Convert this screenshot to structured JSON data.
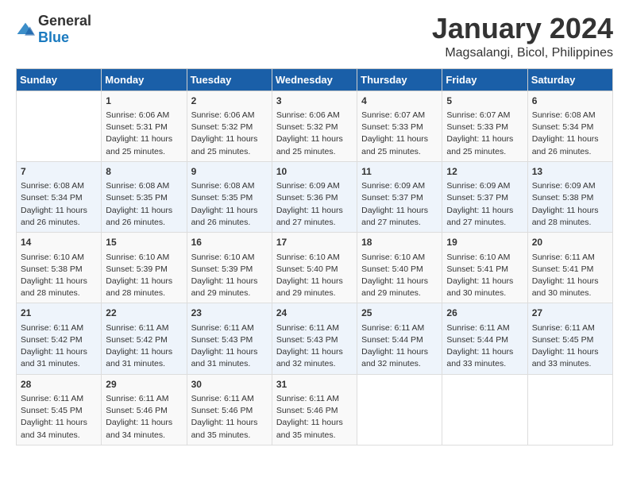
{
  "header": {
    "logo_general": "General",
    "logo_blue": "Blue",
    "month_year": "January 2024",
    "location": "Magsalangi, Bicol, Philippines"
  },
  "days_of_week": [
    "Sunday",
    "Monday",
    "Tuesday",
    "Wednesday",
    "Thursday",
    "Friday",
    "Saturday"
  ],
  "weeks": [
    [
      {
        "day": "",
        "sunrise": "",
        "sunset": "",
        "daylight": ""
      },
      {
        "day": "1",
        "sunrise": "Sunrise: 6:06 AM",
        "sunset": "Sunset: 5:31 PM",
        "daylight": "Daylight: 11 hours and 25 minutes."
      },
      {
        "day": "2",
        "sunrise": "Sunrise: 6:06 AM",
        "sunset": "Sunset: 5:32 PM",
        "daylight": "Daylight: 11 hours and 25 minutes."
      },
      {
        "day": "3",
        "sunrise": "Sunrise: 6:06 AM",
        "sunset": "Sunset: 5:32 PM",
        "daylight": "Daylight: 11 hours and 25 minutes."
      },
      {
        "day": "4",
        "sunrise": "Sunrise: 6:07 AM",
        "sunset": "Sunset: 5:33 PM",
        "daylight": "Daylight: 11 hours and 25 minutes."
      },
      {
        "day": "5",
        "sunrise": "Sunrise: 6:07 AM",
        "sunset": "Sunset: 5:33 PM",
        "daylight": "Daylight: 11 hours and 25 minutes."
      },
      {
        "day": "6",
        "sunrise": "Sunrise: 6:08 AM",
        "sunset": "Sunset: 5:34 PM",
        "daylight": "Daylight: 11 hours and 26 minutes."
      }
    ],
    [
      {
        "day": "7",
        "sunrise": "Sunrise: 6:08 AM",
        "sunset": "Sunset: 5:34 PM",
        "daylight": "Daylight: 11 hours and 26 minutes."
      },
      {
        "day": "8",
        "sunrise": "Sunrise: 6:08 AM",
        "sunset": "Sunset: 5:35 PM",
        "daylight": "Daylight: 11 hours and 26 minutes."
      },
      {
        "day": "9",
        "sunrise": "Sunrise: 6:08 AM",
        "sunset": "Sunset: 5:35 PM",
        "daylight": "Daylight: 11 hours and 26 minutes."
      },
      {
        "day": "10",
        "sunrise": "Sunrise: 6:09 AM",
        "sunset": "Sunset: 5:36 PM",
        "daylight": "Daylight: 11 hours and 27 minutes."
      },
      {
        "day": "11",
        "sunrise": "Sunrise: 6:09 AM",
        "sunset": "Sunset: 5:37 PM",
        "daylight": "Daylight: 11 hours and 27 minutes."
      },
      {
        "day": "12",
        "sunrise": "Sunrise: 6:09 AM",
        "sunset": "Sunset: 5:37 PM",
        "daylight": "Daylight: 11 hours and 27 minutes."
      },
      {
        "day": "13",
        "sunrise": "Sunrise: 6:09 AM",
        "sunset": "Sunset: 5:38 PM",
        "daylight": "Daylight: 11 hours and 28 minutes."
      }
    ],
    [
      {
        "day": "14",
        "sunrise": "Sunrise: 6:10 AM",
        "sunset": "Sunset: 5:38 PM",
        "daylight": "Daylight: 11 hours and 28 minutes."
      },
      {
        "day": "15",
        "sunrise": "Sunrise: 6:10 AM",
        "sunset": "Sunset: 5:39 PM",
        "daylight": "Daylight: 11 hours and 28 minutes."
      },
      {
        "day": "16",
        "sunrise": "Sunrise: 6:10 AM",
        "sunset": "Sunset: 5:39 PM",
        "daylight": "Daylight: 11 hours and 29 minutes."
      },
      {
        "day": "17",
        "sunrise": "Sunrise: 6:10 AM",
        "sunset": "Sunset: 5:40 PM",
        "daylight": "Daylight: 11 hours and 29 minutes."
      },
      {
        "day": "18",
        "sunrise": "Sunrise: 6:10 AM",
        "sunset": "Sunset: 5:40 PM",
        "daylight": "Daylight: 11 hours and 29 minutes."
      },
      {
        "day": "19",
        "sunrise": "Sunrise: 6:10 AM",
        "sunset": "Sunset: 5:41 PM",
        "daylight": "Daylight: 11 hours and 30 minutes."
      },
      {
        "day": "20",
        "sunrise": "Sunrise: 6:11 AM",
        "sunset": "Sunset: 5:41 PM",
        "daylight": "Daylight: 11 hours and 30 minutes."
      }
    ],
    [
      {
        "day": "21",
        "sunrise": "Sunrise: 6:11 AM",
        "sunset": "Sunset: 5:42 PM",
        "daylight": "Daylight: 11 hours and 31 minutes."
      },
      {
        "day": "22",
        "sunrise": "Sunrise: 6:11 AM",
        "sunset": "Sunset: 5:42 PM",
        "daylight": "Daylight: 11 hours and 31 minutes."
      },
      {
        "day": "23",
        "sunrise": "Sunrise: 6:11 AM",
        "sunset": "Sunset: 5:43 PM",
        "daylight": "Daylight: 11 hours and 31 minutes."
      },
      {
        "day": "24",
        "sunrise": "Sunrise: 6:11 AM",
        "sunset": "Sunset: 5:43 PM",
        "daylight": "Daylight: 11 hours and 32 minutes."
      },
      {
        "day": "25",
        "sunrise": "Sunrise: 6:11 AM",
        "sunset": "Sunset: 5:44 PM",
        "daylight": "Daylight: 11 hours and 32 minutes."
      },
      {
        "day": "26",
        "sunrise": "Sunrise: 6:11 AM",
        "sunset": "Sunset: 5:44 PM",
        "daylight": "Daylight: 11 hours and 33 minutes."
      },
      {
        "day": "27",
        "sunrise": "Sunrise: 6:11 AM",
        "sunset": "Sunset: 5:45 PM",
        "daylight": "Daylight: 11 hours and 33 minutes."
      }
    ],
    [
      {
        "day": "28",
        "sunrise": "Sunrise: 6:11 AM",
        "sunset": "Sunset: 5:45 PM",
        "daylight": "Daylight: 11 hours and 34 minutes."
      },
      {
        "day": "29",
        "sunrise": "Sunrise: 6:11 AM",
        "sunset": "Sunset: 5:46 PM",
        "daylight": "Daylight: 11 hours and 34 minutes."
      },
      {
        "day": "30",
        "sunrise": "Sunrise: 6:11 AM",
        "sunset": "Sunset: 5:46 PM",
        "daylight": "Daylight: 11 hours and 35 minutes."
      },
      {
        "day": "31",
        "sunrise": "Sunrise: 6:11 AM",
        "sunset": "Sunset: 5:46 PM",
        "daylight": "Daylight: 11 hours and 35 minutes."
      },
      {
        "day": "",
        "sunrise": "",
        "sunset": "",
        "daylight": ""
      },
      {
        "day": "",
        "sunrise": "",
        "sunset": "",
        "daylight": ""
      },
      {
        "day": "",
        "sunrise": "",
        "sunset": "",
        "daylight": ""
      }
    ]
  ]
}
